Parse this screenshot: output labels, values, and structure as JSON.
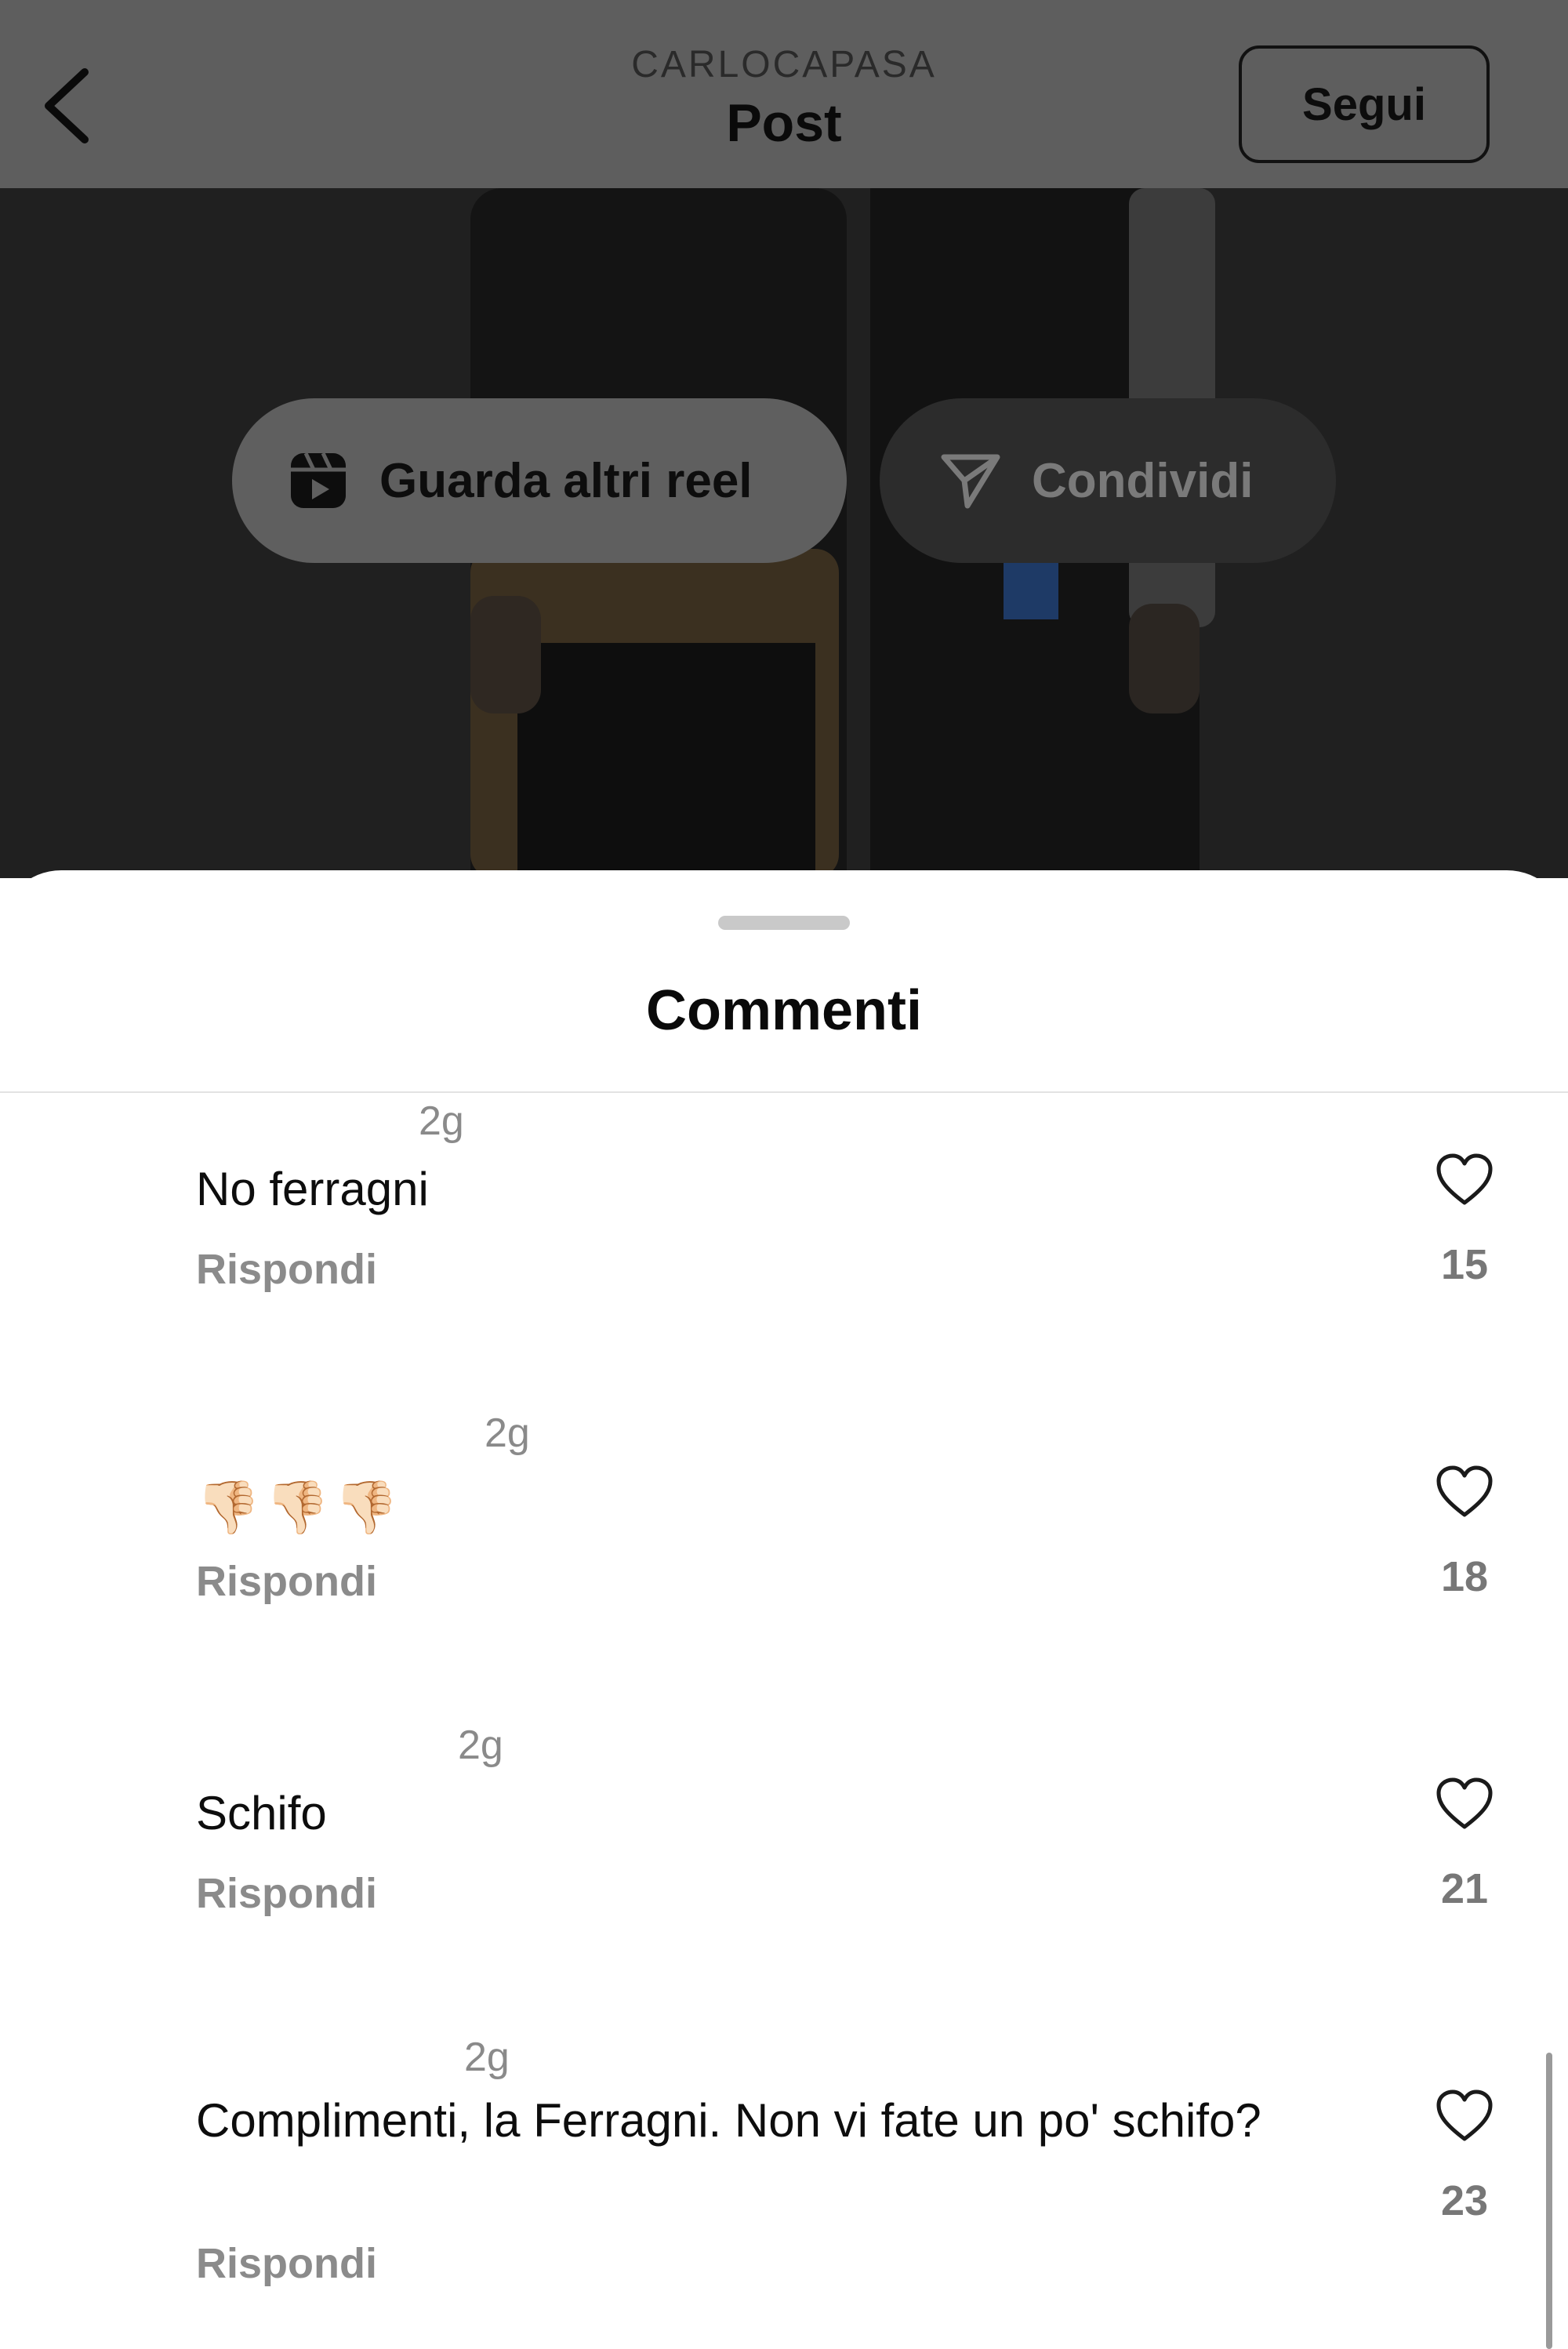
{
  "header": {
    "username": "CARLOCAPASA",
    "title": "Post",
    "follow_label": "Segui"
  },
  "actions": {
    "more_reels_label": "Guarda altri reel",
    "share_label": "Condividi"
  },
  "comments_sheet": {
    "title": "Commenti",
    "comments": [
      {
        "time": "2g",
        "text": "No ferragni",
        "reply_label": "Rispondi",
        "likes": "15"
      },
      {
        "time": "2g",
        "text": "👎🏻👎🏻👎🏻",
        "reply_label": "Rispondi",
        "likes": "18"
      },
      {
        "time": "2g",
        "text": "Schifo",
        "reply_label": "Rispondi",
        "likes": "21"
      },
      {
        "time": "2g",
        "text": "Complimenti, la Ferragni. Non vi fate un po' schifo?",
        "reply_label": "Rispondi",
        "likes": "23"
      }
    ]
  },
  "icons": {
    "back": "chevron-left-icon",
    "reels": "reels-icon",
    "share": "paper-plane-icon",
    "like": "heart-outline-icon"
  }
}
